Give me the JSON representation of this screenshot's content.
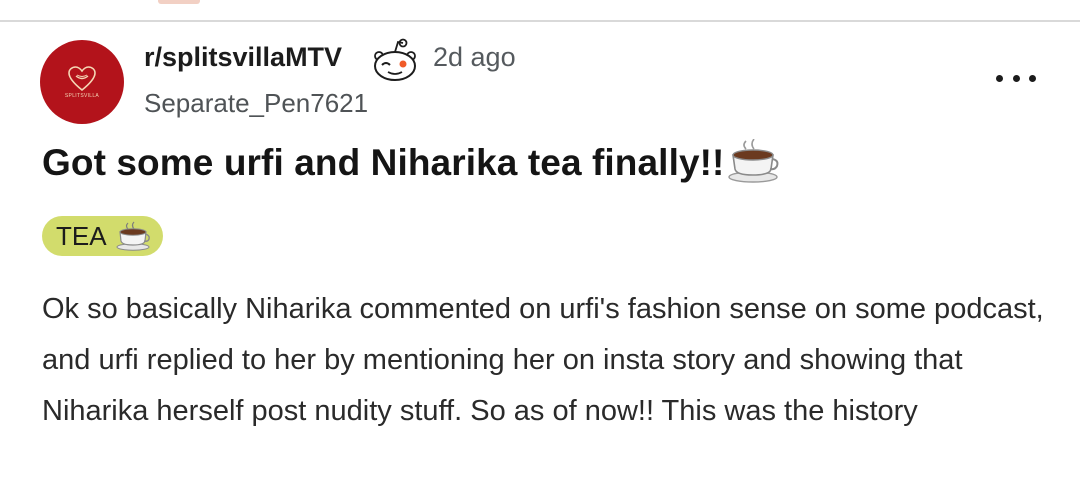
{
  "post": {
    "subreddit": "r/splitsvillaMTV",
    "time": "2d ago",
    "author": "Separate_Pen7621",
    "avatar_text": "SPLITSVILLA",
    "title": "Got some urfi and Niharika tea finally!!",
    "flair": "TEA",
    "body": "Ok so basically Niharika commented on urfi's fashion sense on some podcast, and urfi replied to her by mentioning her on insta story and showing that Niharika herself post nudity stuff. So as of now!! This was the history"
  },
  "colors": {
    "avatar_bg": "#b3131b",
    "flair_bg": "#d2dc6c"
  },
  "icons": {
    "snoo": "snoo-icon",
    "more": "more-options-icon",
    "title_emoji": "hot-beverage-icon",
    "flair_emoji": "hot-beverage-icon"
  }
}
